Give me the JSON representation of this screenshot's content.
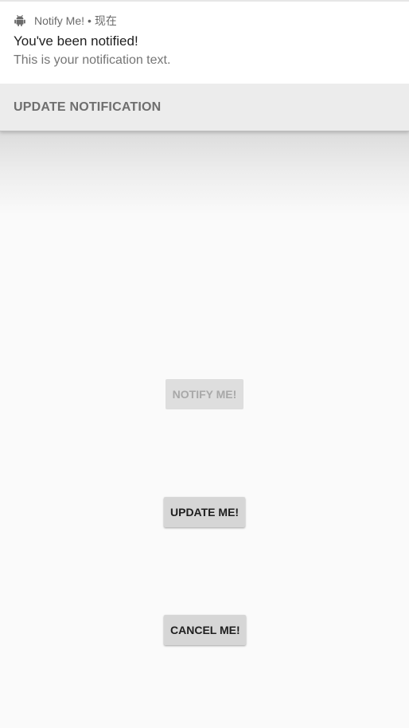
{
  "notification": {
    "app_name": "Notify Me!",
    "separator": "•",
    "time": "现在",
    "app_icon": "android-icon",
    "title": "You've been notified!",
    "text": "This is your notification text.",
    "action_label": "UPDATE NOTIFICATION"
  },
  "buttons": {
    "notify_label": "NOTIFY ME!",
    "notify_enabled": false,
    "update_label": "UPDATE ME!",
    "cancel_label": "CANCEL ME!"
  }
}
